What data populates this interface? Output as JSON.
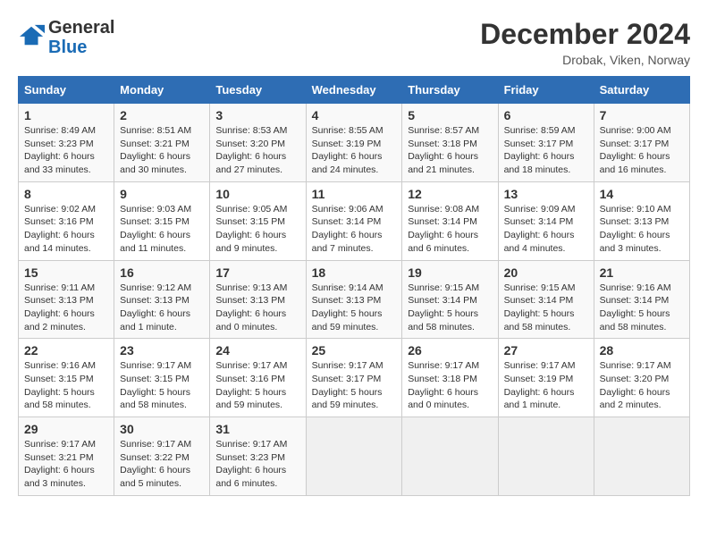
{
  "header": {
    "logo_general": "General",
    "logo_blue": "Blue",
    "month_year": "December 2024",
    "location": "Drobak, Viken, Norway"
  },
  "calendar": {
    "days_of_week": [
      "Sunday",
      "Monday",
      "Tuesday",
      "Wednesday",
      "Thursday",
      "Friday",
      "Saturday"
    ],
    "weeks": [
      [
        {
          "day": "1",
          "info": "Sunrise: 8:49 AM\nSunset: 3:23 PM\nDaylight: 6 hours and 33 minutes."
        },
        {
          "day": "2",
          "info": "Sunrise: 8:51 AM\nSunset: 3:21 PM\nDaylight: 6 hours and 30 minutes."
        },
        {
          "day": "3",
          "info": "Sunrise: 8:53 AM\nSunset: 3:20 PM\nDaylight: 6 hours and 27 minutes."
        },
        {
          "day": "4",
          "info": "Sunrise: 8:55 AM\nSunset: 3:19 PM\nDaylight: 6 hours and 24 minutes."
        },
        {
          "day": "5",
          "info": "Sunrise: 8:57 AM\nSunset: 3:18 PM\nDaylight: 6 hours and 21 minutes."
        },
        {
          "day": "6",
          "info": "Sunrise: 8:59 AM\nSunset: 3:17 PM\nDaylight: 6 hours and 18 minutes."
        },
        {
          "day": "7",
          "info": "Sunrise: 9:00 AM\nSunset: 3:17 PM\nDaylight: 6 hours and 16 minutes."
        }
      ],
      [
        {
          "day": "8",
          "info": "Sunrise: 9:02 AM\nSunset: 3:16 PM\nDaylight: 6 hours and 14 minutes."
        },
        {
          "day": "9",
          "info": "Sunrise: 9:03 AM\nSunset: 3:15 PM\nDaylight: 6 hours and 11 minutes."
        },
        {
          "day": "10",
          "info": "Sunrise: 9:05 AM\nSunset: 3:15 PM\nDaylight: 6 hours and 9 minutes."
        },
        {
          "day": "11",
          "info": "Sunrise: 9:06 AM\nSunset: 3:14 PM\nDaylight: 6 hours and 7 minutes."
        },
        {
          "day": "12",
          "info": "Sunrise: 9:08 AM\nSunset: 3:14 PM\nDaylight: 6 hours and 6 minutes."
        },
        {
          "day": "13",
          "info": "Sunrise: 9:09 AM\nSunset: 3:14 PM\nDaylight: 6 hours and 4 minutes."
        },
        {
          "day": "14",
          "info": "Sunrise: 9:10 AM\nSunset: 3:13 PM\nDaylight: 6 hours and 3 minutes."
        }
      ],
      [
        {
          "day": "15",
          "info": "Sunrise: 9:11 AM\nSunset: 3:13 PM\nDaylight: 6 hours and 2 minutes."
        },
        {
          "day": "16",
          "info": "Sunrise: 9:12 AM\nSunset: 3:13 PM\nDaylight: 6 hours and 1 minute."
        },
        {
          "day": "17",
          "info": "Sunrise: 9:13 AM\nSunset: 3:13 PM\nDaylight: 6 hours and 0 minutes."
        },
        {
          "day": "18",
          "info": "Sunrise: 9:14 AM\nSunset: 3:13 PM\nDaylight: 5 hours and 59 minutes."
        },
        {
          "day": "19",
          "info": "Sunrise: 9:15 AM\nSunset: 3:14 PM\nDaylight: 5 hours and 58 minutes."
        },
        {
          "day": "20",
          "info": "Sunrise: 9:15 AM\nSunset: 3:14 PM\nDaylight: 5 hours and 58 minutes."
        },
        {
          "day": "21",
          "info": "Sunrise: 9:16 AM\nSunset: 3:14 PM\nDaylight: 5 hours and 58 minutes."
        }
      ],
      [
        {
          "day": "22",
          "info": "Sunrise: 9:16 AM\nSunset: 3:15 PM\nDaylight: 5 hours and 58 minutes."
        },
        {
          "day": "23",
          "info": "Sunrise: 9:17 AM\nSunset: 3:15 PM\nDaylight: 5 hours and 58 minutes."
        },
        {
          "day": "24",
          "info": "Sunrise: 9:17 AM\nSunset: 3:16 PM\nDaylight: 5 hours and 59 minutes."
        },
        {
          "day": "25",
          "info": "Sunrise: 9:17 AM\nSunset: 3:17 PM\nDaylight: 5 hours and 59 minutes."
        },
        {
          "day": "26",
          "info": "Sunrise: 9:17 AM\nSunset: 3:18 PM\nDaylight: 6 hours and 0 minutes."
        },
        {
          "day": "27",
          "info": "Sunrise: 9:17 AM\nSunset: 3:19 PM\nDaylight: 6 hours and 1 minute."
        },
        {
          "day": "28",
          "info": "Sunrise: 9:17 AM\nSunset: 3:20 PM\nDaylight: 6 hours and 2 minutes."
        }
      ],
      [
        {
          "day": "29",
          "info": "Sunrise: 9:17 AM\nSunset: 3:21 PM\nDaylight: 6 hours and 3 minutes."
        },
        {
          "day": "30",
          "info": "Sunrise: 9:17 AM\nSunset: 3:22 PM\nDaylight: 6 hours and 5 minutes."
        },
        {
          "day": "31",
          "info": "Sunrise: 9:17 AM\nSunset: 3:23 PM\nDaylight: 6 hours and 6 minutes."
        },
        null,
        null,
        null,
        null
      ]
    ]
  }
}
